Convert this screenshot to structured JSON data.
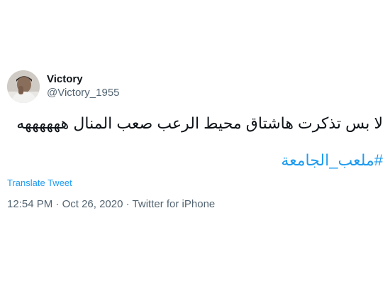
{
  "author": {
    "display_name": "Victory",
    "handle": "@Victory_1955",
    "avatar_icon": "user-avatar-photo"
  },
  "tweet": {
    "text": "لا بس تذكرت هاشتاق محيط الرعب صعب المنال ههههههه",
    "hashtag": "#ملعب_الجامعة",
    "translate_label": "Translate Tweet"
  },
  "meta": {
    "time": "12:54 PM",
    "separator": " · ",
    "date": "Oct 26, 2020",
    "source": "Twitter for iPhone"
  },
  "colors": {
    "link": "#1d9bf0",
    "text": "#0f1419",
    "secondary": "#536471"
  }
}
